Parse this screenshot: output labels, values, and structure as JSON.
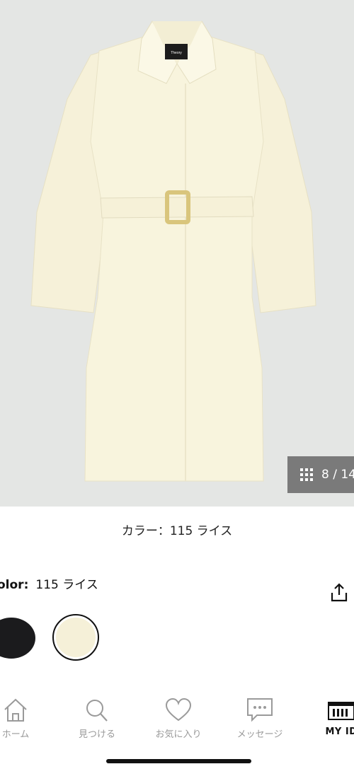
{
  "gallery": {
    "counter": "8 / 14",
    "brand_tag": "Theory",
    "caption": "カラー：115 ライス"
  },
  "product": {
    "color_label": "olor:",
    "color_value": "115 ライス",
    "swatches": [
      {
        "name": "black",
        "color": "#1b1b1d",
        "selected": false
      },
      {
        "name": "rice",
        "color": "#f5f0d8",
        "selected": true
      }
    ]
  },
  "nav": {
    "items": [
      {
        "label": "ホーム",
        "icon": "home-icon"
      },
      {
        "label": "見つける",
        "icon": "search-icon"
      },
      {
        "label": "お気に入り",
        "icon": "heart-icon"
      },
      {
        "label": "メッセージ",
        "icon": "message-icon"
      },
      {
        "label": "MY ID",
        "icon": "barcode-icon"
      }
    ]
  },
  "colors": {
    "background_image": "#e4e6e4",
    "coat": "#f8f4dd",
    "buckle": "#d9c57c",
    "counter_bg": "#7a7a7a"
  }
}
